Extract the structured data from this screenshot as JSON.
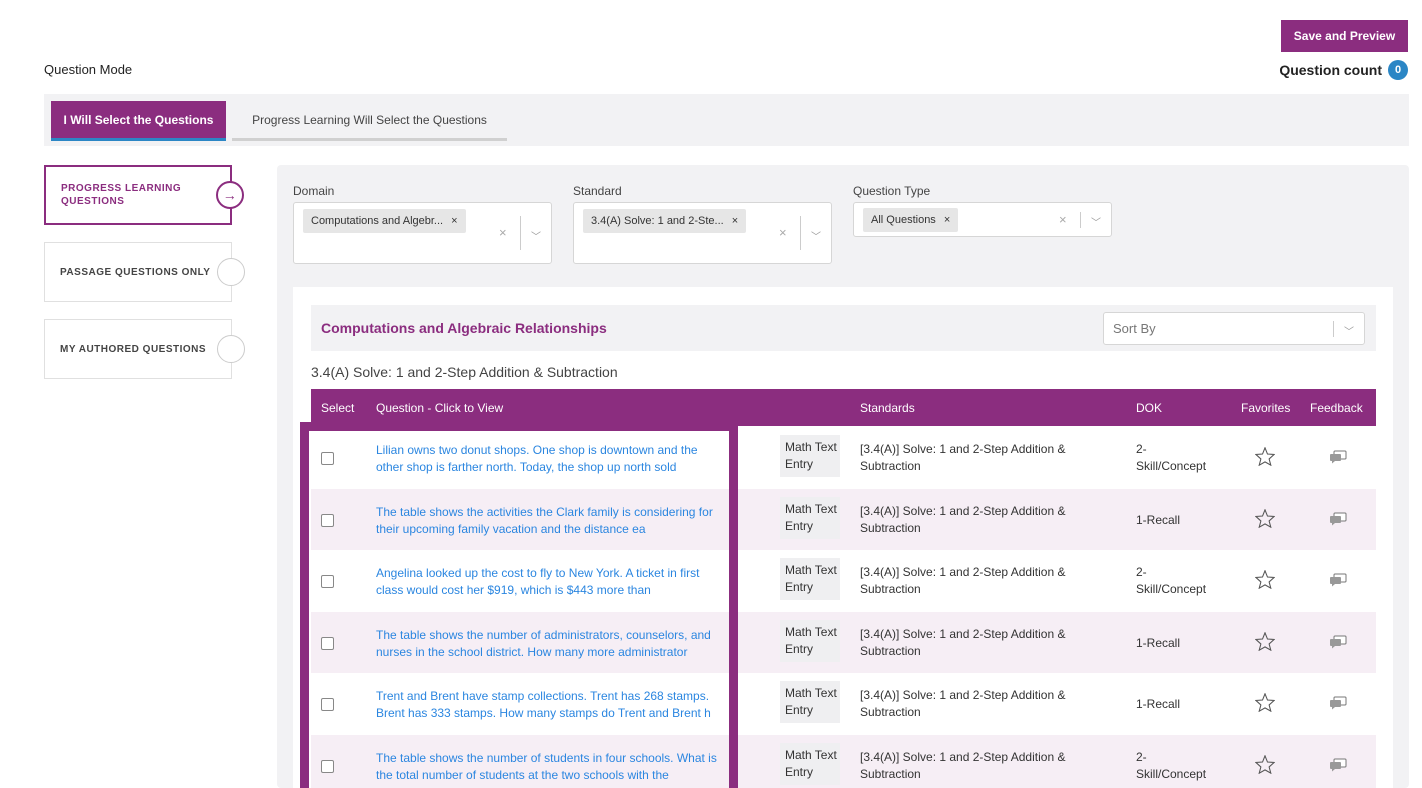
{
  "header": {
    "save_preview_label": "Save and Preview",
    "question_mode_label": "Question Mode",
    "question_count_label": "Question count",
    "question_count_value": "0"
  },
  "tabs": [
    {
      "label": "I Will Select the Questions",
      "active": true
    },
    {
      "label": "Progress Learning Will Select the Questions",
      "active": false
    }
  ],
  "sidebar": {
    "items": [
      {
        "label": "PROGRESS LEARNING QUESTIONS",
        "active": true
      },
      {
        "label": "PASSAGE QUESTIONS ONLY",
        "active": false
      },
      {
        "label": "MY AUTHORED QUESTIONS",
        "active": false
      }
    ]
  },
  "filters": {
    "domain": {
      "label": "Domain",
      "chip": "Computations and Algebr..."
    },
    "standard": {
      "label": "Standard",
      "chip": "3.4(A) Solve: 1 and 2-Ste..."
    },
    "question_type": {
      "label": "Question Type",
      "chip": "All Questions"
    }
  },
  "section": {
    "domain_title": "Computations and Algebraic Relationships",
    "sort_by_placeholder": "Sort By",
    "standard_title": "3.4(A) Solve: 1 and 2-Step Addition & Subtraction"
  },
  "table": {
    "headers": {
      "select": "Select",
      "question": "Question - Click to View",
      "standards": "Standards",
      "dok": "DOK",
      "favorites": "Favorites",
      "feedback": "Feedback"
    },
    "rows": [
      {
        "q1": "Lilian owns two donut shops. One shop is downtown and the",
        "q2": "other shop is farther north. Today, the shop up north sold",
        "type1": "Math Text",
        "type2": "Entry",
        "std1": "[3.4(A)] Solve: 1 and 2-Step Addition &",
        "std2": "Subtraction",
        "dok1": "2-",
        "dok2": "Skill/Concept"
      },
      {
        "q1": "The table shows the activities the Clark family is considering for",
        "q2": "their upcoming family vacation and the distance ea",
        "type1": "Math Text",
        "type2": "Entry",
        "std1": "[3.4(A)] Solve: 1 and 2-Step Addition &",
        "std2": "Subtraction",
        "dok1": "1-Recall",
        "dok2": ""
      },
      {
        "q1": "Angelina looked up the cost to fly to New York. A ticket in first",
        "q2": "class would cost her $919, which is $443 more than",
        "type1": "Math Text",
        "type2": "Entry",
        "std1": "[3.4(A)] Solve: 1 and 2-Step Addition &",
        "std2": "Subtraction",
        "dok1": "2-",
        "dok2": "Skill/Concept"
      },
      {
        "q1": "The table shows the number of administrators, counselors, and",
        "q2": "nurses in the school district. How many more administrator",
        "type1": "Math Text",
        "type2": "Entry",
        "std1": "[3.4(A)] Solve: 1 and 2-Step Addition &",
        "std2": "Subtraction",
        "dok1": "1-Recall",
        "dok2": ""
      },
      {
        "q1": "Trent and Brent have stamp collections. Trent has 268 stamps.",
        "q2": "Brent has 333 stamps. How many stamps do Trent and Brent h",
        "type1": "Math Text",
        "type2": "Entry",
        "std1": "[3.4(A)] Solve: 1 and 2-Step Addition &",
        "std2": "Subtraction",
        "dok1": "1-Recall",
        "dok2": ""
      },
      {
        "q1": "The table shows the number of students in four schools. What is",
        "q2": "the total number of students at the two schools with the",
        "type1": "Math Text",
        "type2": "Entry",
        "std1": "[3.4(A)] Solve: 1 and 2-Step Addition &",
        "std2": "Subtraction",
        "dok1": "2-",
        "dok2": "Skill/Concept"
      }
    ]
  },
  "colors": {
    "brand": "#8b2d7f",
    "link": "#2b86e0",
    "badge": "#2b86c5"
  }
}
